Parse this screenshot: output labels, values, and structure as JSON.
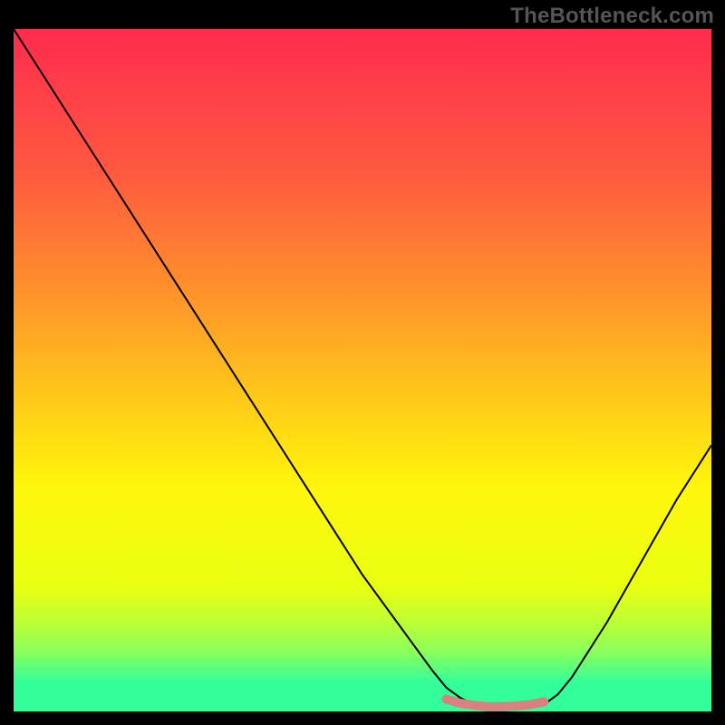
{
  "watermark": "TheBottleneck.com",
  "chart_data": {
    "type": "line",
    "title": "",
    "xlabel": "",
    "ylabel": "",
    "xlim": [
      0,
      100
    ],
    "ylim": [
      0,
      100
    ],
    "legend": false,
    "grid": false,
    "background_gradient_colors": [
      "#ff2b4e",
      "#ff5840",
      "#ff8d2d",
      "#ffc31b",
      "#fff60b",
      "#eaff10",
      "#c1ff31",
      "#8bff5a",
      "#32ff9a"
    ],
    "gradient_band_heights_percent": [
      20.6,
      16.5,
      15.3,
      14.6,
      14.6,
      4.8,
      4.8,
      4.6,
      4.1
    ],
    "series": [
      {
        "name": "curve",
        "color": "#000000",
        "stroke_width": 2,
        "x": [
          0,
          5,
          10,
          15,
          20,
          25,
          30,
          35,
          40,
          45,
          50,
          55,
          60,
          62,
          64,
          66,
          68,
          70,
          72,
          74,
          76,
          78,
          80,
          85,
          90,
          95,
          100
        ],
        "y": [
          100,
          92,
          84,
          76,
          68,
          60,
          52,
          44,
          36,
          28,
          20,
          13,
          6,
          3.5,
          2,
          1,
          0.5,
          0.3,
          0.3,
          0.5,
          1,
          2.5,
          5,
          13,
          22,
          31,
          39
        ]
      },
      {
        "name": "highlight-band",
        "color": "#d98080",
        "stroke_width": 10,
        "linecap": "round",
        "x": [
          62,
          64,
          66,
          68,
          70,
          72,
          74,
          76
        ],
        "y": [
          1.8,
          1.2,
          0.9,
          0.7,
          0.7,
          0.8,
          1.0,
          1.4
        ]
      }
    ]
  }
}
